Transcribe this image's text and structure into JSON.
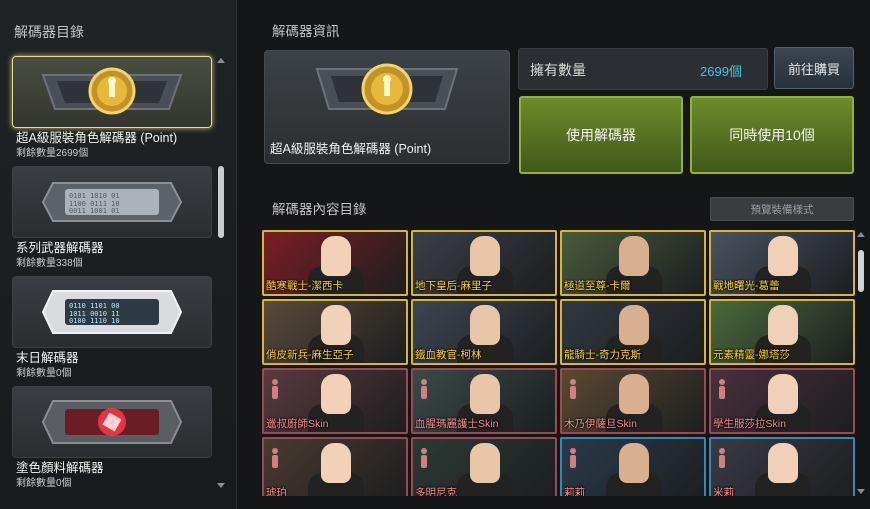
{
  "sidebar": {
    "title": "解碼器目錄",
    "items": [
      {
        "name": "超A級服裝角色解碼器 (Point)",
        "count": "剩餘數量2699個",
        "selected": true,
        "icon": "gold-decoder-icon"
      },
      {
        "name": "系列武器解碼器",
        "count": "剩餘數量338個",
        "selected": false,
        "icon": "weapon-decoder-icon"
      },
      {
        "name": "末日解碼器",
        "count": "剩餘數量0個",
        "selected": false,
        "icon": "doomsday-decoder-icon"
      },
      {
        "name": "塗色顏料解碼器",
        "count": "剩餘數量0個",
        "selected": false,
        "icon": "paint-decoder-icon"
      }
    ]
  },
  "info": {
    "title": "解碼器資訊",
    "decoder_name": "超A級服裝角色解碼器 (Point)",
    "owned_label": "擁有數量",
    "owned_value": "2699個",
    "buy_label": "前往購買",
    "use_label": "使用解碼器",
    "use10_label": "同時使用10個"
  },
  "contents": {
    "title": "解碼器內容目錄",
    "preview_label": "預覽裝備樣式",
    "items": [
      {
        "label": "酷寒戰士-潔西卡",
        "frame": "gold"
      },
      {
        "label": "地下皇后-麻里子",
        "frame": "gold"
      },
      {
        "label": "極道至尊-卡爾",
        "frame": "gold"
      },
      {
        "label": "戰地曙光-葛蕾",
        "frame": "gold"
      },
      {
        "label": "俏皮新兵-麻生亞子",
        "frame": "gold"
      },
      {
        "label": "鐵血教官-柯林",
        "frame": "gold"
      },
      {
        "label": "龍騎士-奇力克斯",
        "frame": "gold"
      },
      {
        "label": "元素精靈-娜塔莎",
        "frame": "gold"
      },
      {
        "label": "邋叔廚師Skin",
        "frame": "red"
      },
      {
        "label": "血腥瑪麗護士Skin",
        "frame": "red"
      },
      {
        "label": "木乃伊薩旦Skin",
        "frame": "red"
      },
      {
        "label": "學生服莎拉Skin",
        "frame": "red"
      },
      {
        "label": "琥珀",
        "frame": "red"
      },
      {
        "label": "多明尼克",
        "frame": "red"
      },
      {
        "label": "莉莉",
        "frame": "blue"
      },
      {
        "label": "米莉",
        "frame": "blue"
      }
    ]
  },
  "colors": {
    "accent_blue": "#46c2e6",
    "gold_frame": "#d9b43a",
    "red_frame": "#9a4a52",
    "green_button": "#5a7722",
    "gold_label": "#ffd23a",
    "red_label": "#ff8c8c"
  }
}
